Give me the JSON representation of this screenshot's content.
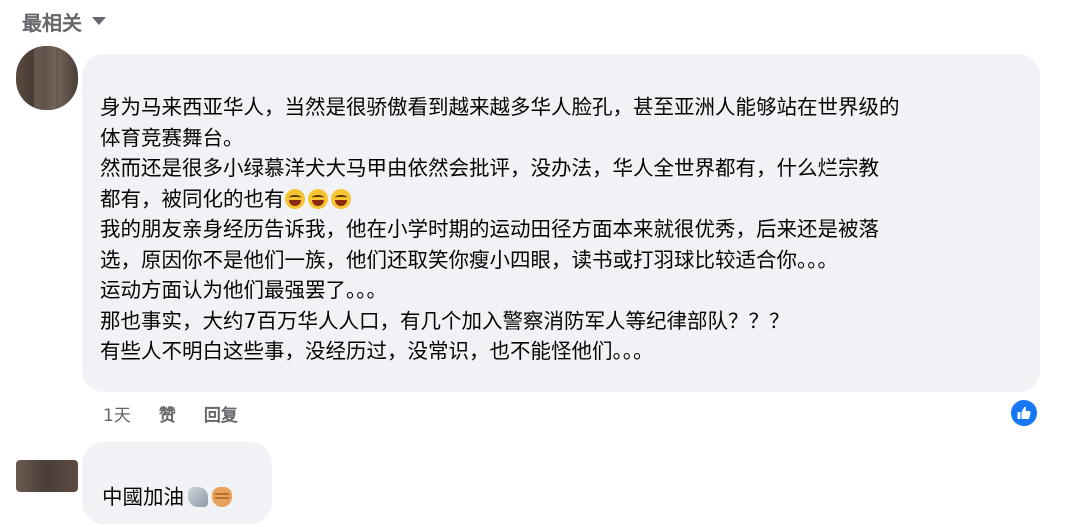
{
  "sort": {
    "label": "最相关",
    "icon": "chevron-down-icon"
  },
  "comments": [
    {
      "text_lines": [
        "身为马来西亚华人，当然是很骄傲看到越来越多华人脸孔，甚至亚洲人能够站在世界级的",
        "体育竞赛舞台。",
        "然而还是很多小绿慕洋犬大马甲由依然会批评，没办法，华人全世界都有，什么烂宗教",
        "都有，被同化的也有",
        "我的朋友亲身经历告诉我，他在小学时期的运动田径方面本来就很优秀，后来还是被落",
        "选，原因你不是他们一族，他们还取笑你瘦小四眼，读书或打羽球比较适合你。。。",
        "运动方面认为他们最强罢了。。。",
        "那也事实，大约7百万华人人口，有几个加入警察消防军人等纪律部队？？？",
        "有些人不明白这些事，没经历过，没常识，也不能怪他们。。。"
      ],
      "emoji": "face-with-tears-of-joy",
      "emoji_count": 3,
      "timestamp": "1天",
      "like_label": "赞",
      "reply_label": "回复",
      "reaction_icon": "thumbs-up-icon"
    },
    {
      "text": "中國加油",
      "emojis": [
        "flexed-arm-icon",
        "fist-icon"
      ]
    }
  ],
  "colors": {
    "bubble": "#f0f2f5",
    "secondary_text": "#65676b",
    "like_blue": "#1877f2"
  }
}
